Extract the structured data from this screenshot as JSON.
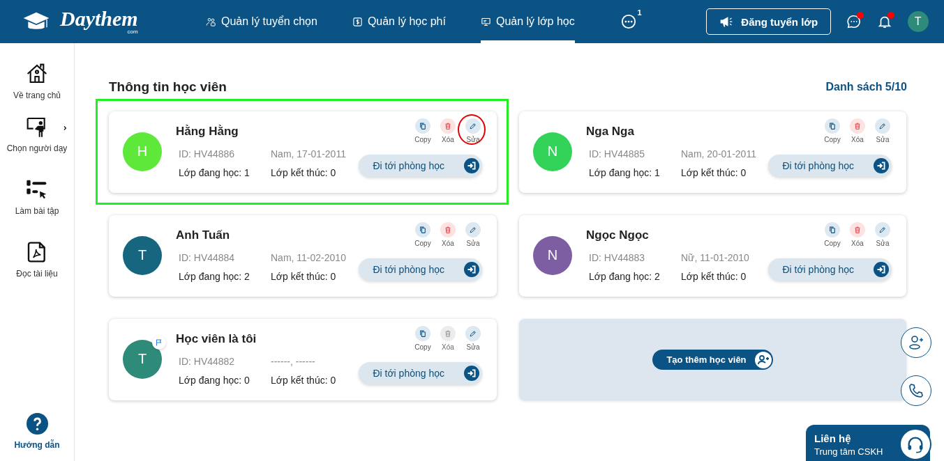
{
  "header": {
    "logo": {
      "name": "Daythem",
      "suffix": "com"
    },
    "nav": [
      {
        "label": "Quản lý tuyển chọn",
        "kind": "people",
        "selected": false
      },
      {
        "label": "Quản lý học phí",
        "kind": "money",
        "selected": false
      },
      {
        "label": "Quản lý lớp học",
        "kind": "board",
        "selected": true
      }
    ],
    "more_badge": "1",
    "post_button": "Đăng tuyển lớp",
    "chat_unread": true,
    "notifications_unread": true,
    "avatar": "T"
  },
  "sidebar": {
    "items": [
      {
        "label": "Về trang chủ",
        "kind": "home",
        "has_submenu": false
      },
      {
        "label": "Chọn người dạy",
        "kind": "teacher",
        "has_submenu": true
      },
      {
        "label": "Làm bài tập",
        "kind": "quiz",
        "has_submenu": false
      },
      {
        "label": "Đọc tài liệu",
        "kind": "pdf",
        "has_submenu": false
      }
    ],
    "help": "Hướng dẫn"
  },
  "title": "Thông tin học viên",
  "list_count": "Danh sách 5/10",
  "students": [
    {
      "initial": "H",
      "color": "#5ee83a",
      "name": "Hằng Hằng",
      "id": "ID: HV44886",
      "info": "Nam, 17-01-2011",
      "active_classes": "Lớp đang học: 1",
      "finished_classes": "Lớp kết thúc: 0",
      "flagged": false,
      "highlighted": true,
      "enter_button": "Đi tới phòng học",
      "actions": [
        {
          "kind": "copy",
          "label": "Copy",
          "disabled": false,
          "circled": false
        },
        {
          "kind": "delete",
          "label": "Xóa",
          "disabled": false,
          "circled": false
        },
        {
          "kind": "edit",
          "label": "Sửa",
          "disabled": false,
          "circled": true
        }
      ]
    },
    {
      "initial": "N",
      "color": "#33d35a",
      "name": "Nga Nga",
      "id": "ID: HV44885",
      "info": "Nam, 20-01-2011",
      "active_classes": "Lớp đang học: 1",
      "finished_classes": "Lớp kết thúc: 0",
      "flagged": false,
      "highlighted": false,
      "enter_button": "Đi tới phòng học",
      "actions": [
        {
          "kind": "copy",
          "label": "Copy",
          "disabled": false,
          "circled": false
        },
        {
          "kind": "delete",
          "label": "Xóa",
          "disabled": false,
          "circled": false
        },
        {
          "kind": "edit",
          "label": "Sửa",
          "disabled": false,
          "circled": false
        }
      ]
    },
    {
      "initial": "T",
      "color": "#176680",
      "name": "Anh Tuấn",
      "id": "ID: HV44884",
      "info": "Nam, 11-02-2010",
      "active_classes": "Lớp đang học: 2",
      "finished_classes": "Lớp kết thúc: 0",
      "flagged": false,
      "highlighted": false,
      "enter_button": "Đi tới phòng học",
      "actions": [
        {
          "kind": "copy",
          "label": "Copy",
          "disabled": false,
          "circled": false
        },
        {
          "kind": "delete",
          "label": "Xóa",
          "disabled": false,
          "circled": false
        },
        {
          "kind": "edit",
          "label": "Sửa",
          "disabled": false,
          "circled": false
        }
      ]
    },
    {
      "initial": "N",
      "color": "#7d5ea3",
      "name": "Ngọc Ngọc",
      "id": "ID: HV44883",
      "info": "Nữ, 11-01-2010",
      "active_classes": "Lớp đang học: 2",
      "finished_classes": "Lớp kết thúc: 0",
      "flagged": false,
      "highlighted": false,
      "enter_button": "Đi tới phòng học",
      "actions": [
        {
          "kind": "copy",
          "label": "Copy",
          "disabled": false,
          "circled": false
        },
        {
          "kind": "delete",
          "label": "Xóa",
          "disabled": false,
          "circled": false
        },
        {
          "kind": "edit",
          "label": "Sửa",
          "disabled": false,
          "circled": false
        }
      ]
    },
    {
      "initial": "T",
      "color": "#2e8b7a",
      "name": "Học viên là tôi",
      "id": "ID: HV44882",
      "info": "------, ------",
      "active_classes": "Lớp đang học: 0",
      "finished_classes": "Lớp kết thúc: 0",
      "flagged": true,
      "highlighted": false,
      "enter_button": "Đi tới phòng học",
      "actions": [
        {
          "kind": "copy",
          "label": "Copy",
          "disabled": false,
          "circled": false
        },
        {
          "kind": "delete",
          "label": "Xóa",
          "disabled": true,
          "circled": false
        },
        {
          "kind": "edit",
          "label": "Sửa",
          "disabled": false,
          "circled": false
        }
      ]
    }
  ],
  "add_student_button": "Tạo thêm học viên",
  "contact": {
    "title": "Liên hệ",
    "subtitle": "Trung tâm CSKH"
  }
}
